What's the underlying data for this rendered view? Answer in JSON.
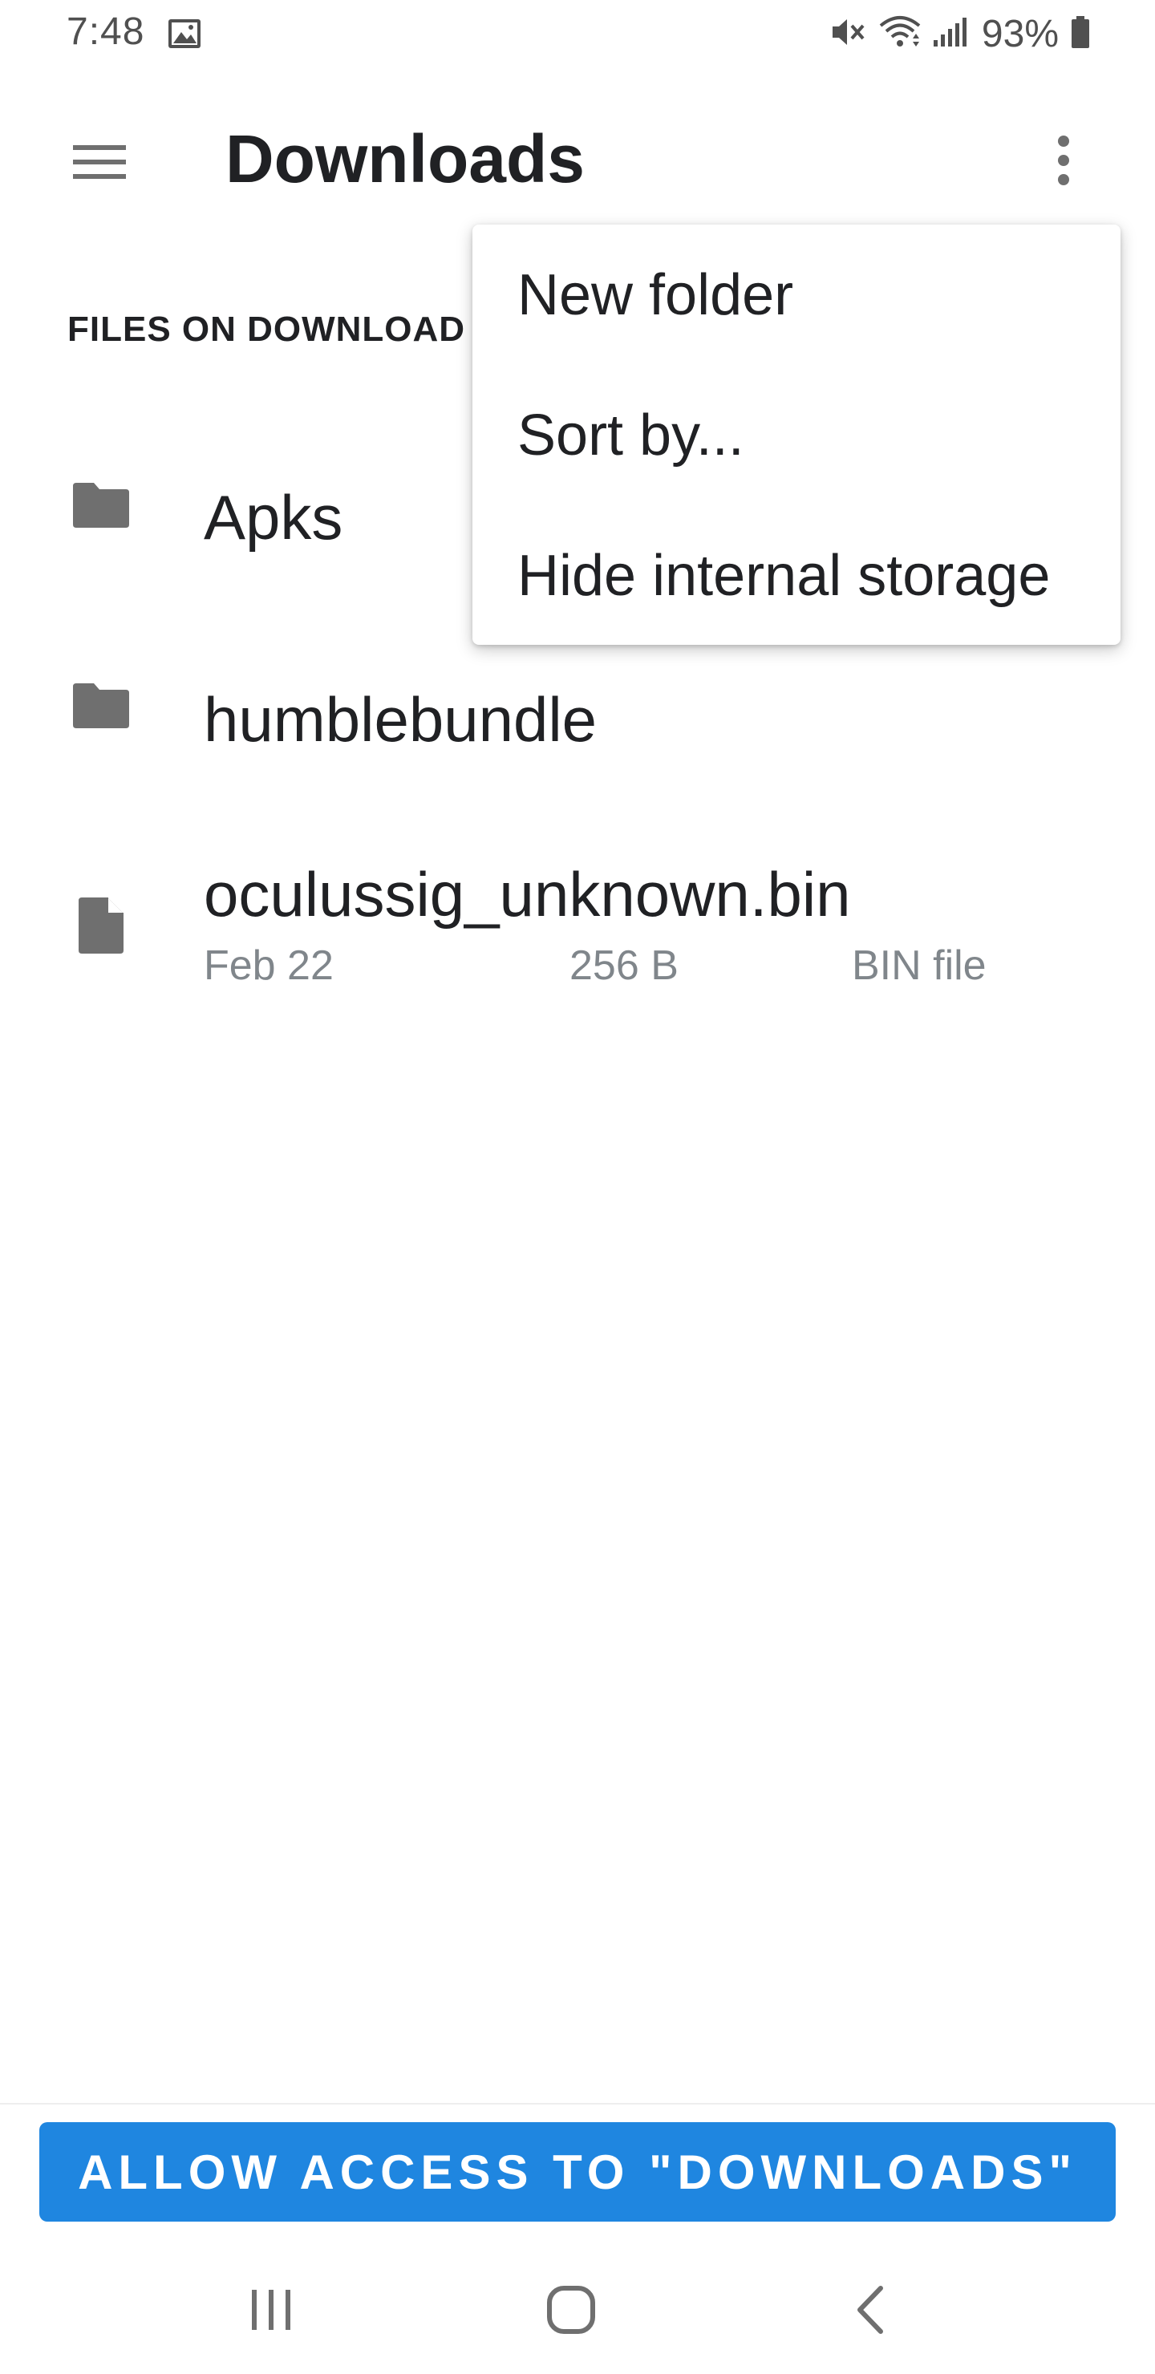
{
  "status_bar": {
    "time": "7:48",
    "battery": "93%",
    "icons": [
      "gallery-icon",
      "mute-icon",
      "wifi-icon",
      "signal-icon",
      "battery-icon"
    ]
  },
  "app_bar": {
    "title": "Downloads",
    "menu_icon": "hamburger-menu-icon",
    "overflow_icon": "more-vert-icon"
  },
  "section": {
    "header": "FILES ON DOWNLOAD"
  },
  "files": [
    {
      "name": "Apks",
      "type": "folder",
      "icon": "folder-icon"
    },
    {
      "name": "humblebundle",
      "type": "folder",
      "icon": "folder-icon"
    },
    {
      "name": "oculussig_unknown.bin",
      "type": "file",
      "icon": "file-icon",
      "date": "Feb 22",
      "size": "256 B",
      "kind": "BIN file"
    }
  ],
  "popup_menu": {
    "items": [
      {
        "label": "New folder"
      },
      {
        "label": "Sort by..."
      },
      {
        "label": "Hide internal storage"
      }
    ]
  },
  "bottom": {
    "allow_label": "ALLOW ACCESS TO \"DOWNLOADS\""
  },
  "colors": {
    "accent": "#1f86e0",
    "icon_gray": "#6f6f6f",
    "text_primary": "#202124",
    "text_secondary": "#80868b"
  },
  "nav_bar": {
    "icons": [
      "recent-apps-icon",
      "home-icon",
      "back-icon"
    ]
  }
}
